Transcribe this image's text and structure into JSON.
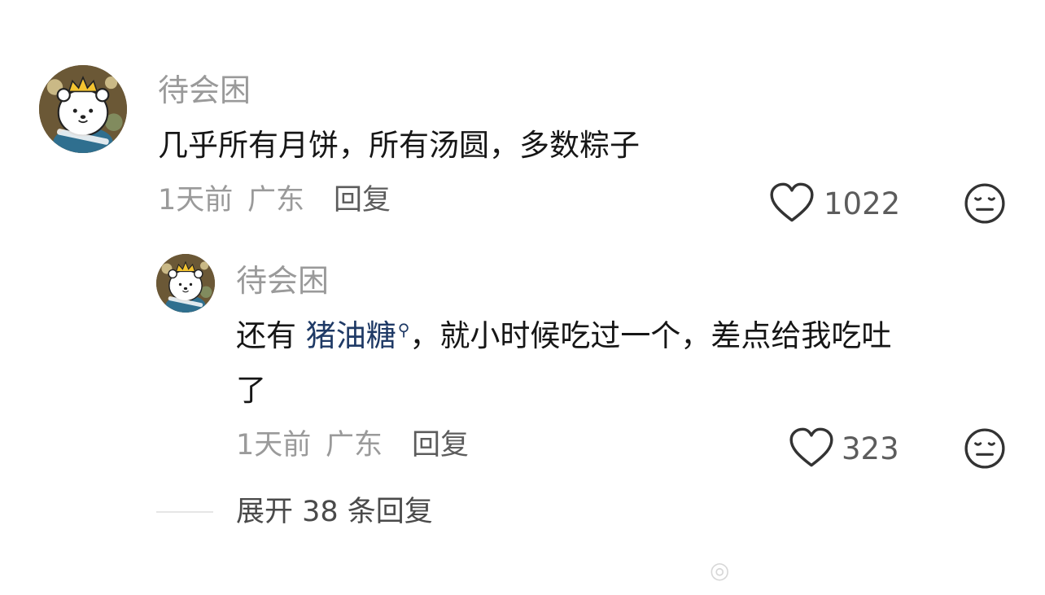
{
  "comments": [
    {
      "username": "待会困",
      "text": "几乎所有月饼，所有汤圆，多数粽子",
      "time": "1天前",
      "location": "广东",
      "reply_label": "回复",
      "likes": "1022",
      "like_icon": "heart-outline-icon",
      "dislike_icon": "meh-face-icon"
    },
    {
      "username": "待会困",
      "text_before": "还有",
      "keyword": "猪油糖",
      "text_after": "，就小时候吃过一个，差点给我吃吐",
      "text_line2": "了",
      "time": "1天前",
      "location": "广东",
      "reply_label": "回复",
      "likes": "323",
      "like_icon": "heart-outline-icon",
      "dislike_icon": "meh-face-icon"
    }
  ],
  "expand_replies_label": "展开 38 条回复",
  "colors": {
    "keyword": "#1f3a66",
    "muted": "#9a9a9a"
  }
}
